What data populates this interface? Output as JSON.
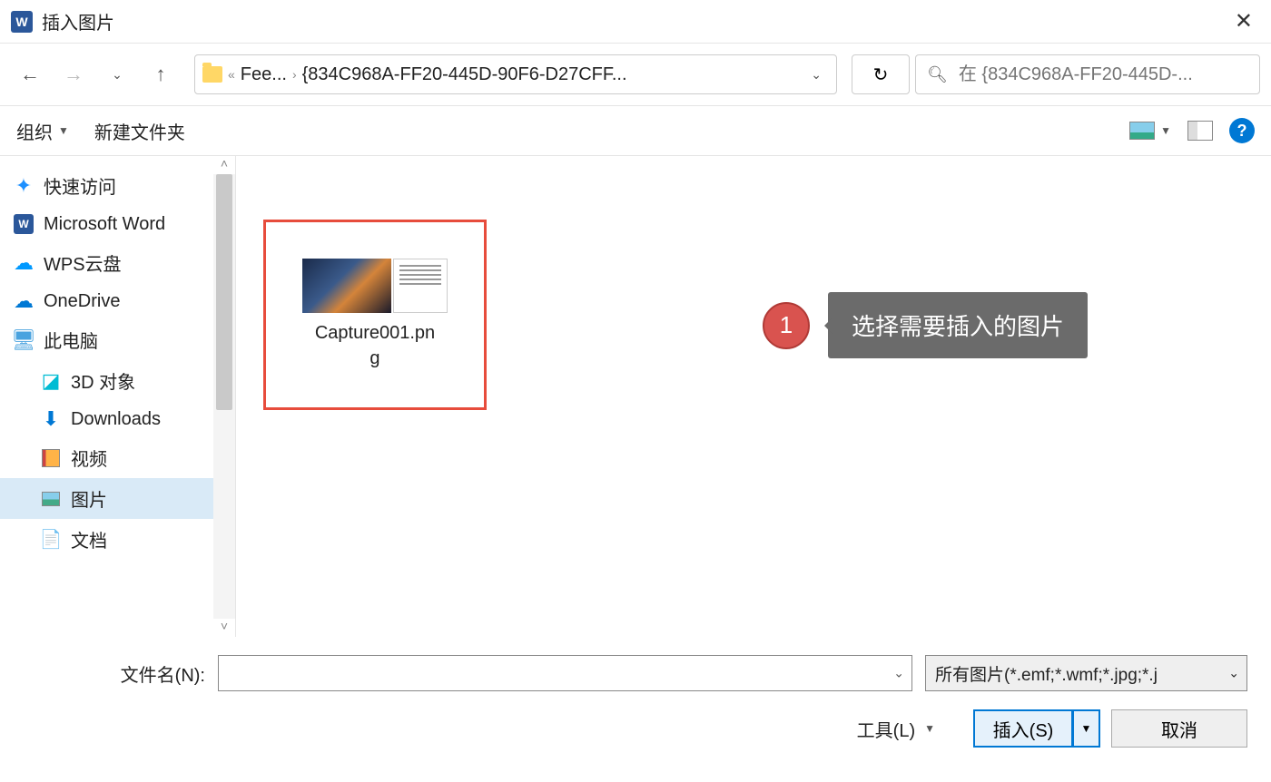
{
  "titlebar": {
    "title": "插入图片"
  },
  "nav": {
    "breadcrumb": {
      "prefix": "«",
      "part1": "Fee...",
      "part2": "{834C968A-FF20-445D-90F6-D27CFF..."
    },
    "search_placeholder": "在 {834C968A-FF20-445D-..."
  },
  "toolbar": {
    "organize": "组织",
    "new_folder": "新建文件夹"
  },
  "sidebar": {
    "items": [
      {
        "label": "快速访问",
        "icon": "star"
      },
      {
        "label": "Microsoft Word",
        "icon": "word"
      },
      {
        "label": "WPS云盘",
        "icon": "wps"
      },
      {
        "label": "OneDrive",
        "icon": "onedrive"
      },
      {
        "label": "此电脑",
        "icon": "pc"
      },
      {
        "label": "3D 对象",
        "icon": "3d",
        "indent": true
      },
      {
        "label": "Downloads",
        "icon": "dl",
        "indent": true
      },
      {
        "label": "视频",
        "icon": "video",
        "indent": true
      },
      {
        "label": "图片",
        "icon": "pic",
        "indent": true,
        "selected": true
      },
      {
        "label": "文档",
        "icon": "doc",
        "indent": true
      }
    ]
  },
  "content": {
    "file": {
      "name_line1": "Capture001.pn",
      "name_line2": "g"
    }
  },
  "callout": {
    "badge": "1",
    "text": "选择需要插入的图片"
  },
  "bottom": {
    "filename_label": "文件名(N):",
    "filename_value": "",
    "filter": "所有图片(*.emf;*.wmf;*.jpg;*.j",
    "tools": "工具(L)",
    "insert": "插入(S)",
    "cancel": "取消"
  }
}
